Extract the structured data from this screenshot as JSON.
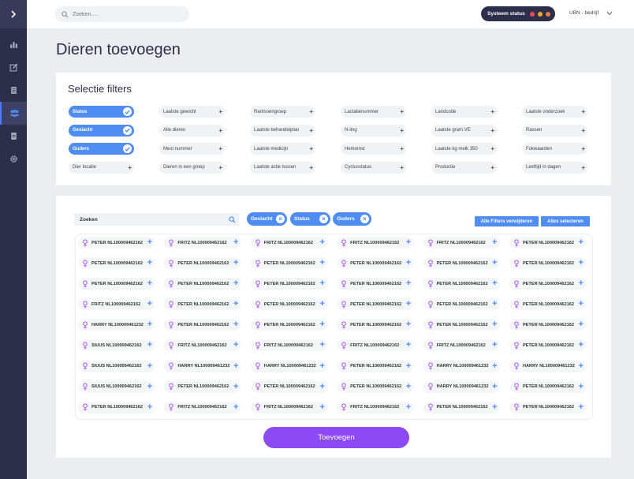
{
  "header": {
    "search_placeholder": "Zoeken.....",
    "system_status_label": "Systeem status",
    "status_colors": [
      "#e74c5e",
      "#f5a623",
      "#f07a3a"
    ],
    "user_label": "UBN - bedrijf"
  },
  "page": {
    "title": "Dieren toevoegen"
  },
  "filters": {
    "title": "Selectie filters",
    "items": [
      {
        "label": "Status",
        "selected": true
      },
      {
        "label": "Laatste gewicht",
        "selected": false
      },
      {
        "label": "Rantsoengroep",
        "selected": false
      },
      {
        "label": "Lactatienummer",
        "selected": false
      },
      {
        "label": "Landcode",
        "selected": false
      },
      {
        "label": "Laatste onderzoek",
        "selected": false
      },
      {
        "label": "Geslacht",
        "selected": true
      },
      {
        "label": "Alle dieren",
        "selected": false
      },
      {
        "label": "Laatste behandelplan",
        "selected": false
      },
      {
        "label": "N-ling",
        "selected": false
      },
      {
        "label": "Laatste gram VE",
        "selected": false
      },
      {
        "label": "Rassen",
        "selected": false
      },
      {
        "label": "Ouders",
        "selected": true
      },
      {
        "label": "Mest nummer",
        "selected": false
      },
      {
        "label": "Laatste medicijn",
        "selected": false
      },
      {
        "label": "Herkomst",
        "selected": false
      },
      {
        "label": "Laatste kg melk 350",
        "selected": false
      },
      {
        "label": "Fokwaarden",
        "selected": false
      },
      {
        "label": "Dier locatie",
        "selected": false
      },
      {
        "label": "Dieren in een groep",
        "selected": false
      },
      {
        "label": "Laatste actie tussen",
        "selected": false
      },
      {
        "label": "Cyclusstatus",
        "selected": false
      },
      {
        "label": "Productie",
        "selected": false
      },
      {
        "label": "Leeftijd in dagen",
        "selected": false
      }
    ]
  },
  "animals": {
    "search_placeholder": "Zoeken",
    "active_tags": [
      "Geslacht",
      "Status",
      "Ouders"
    ],
    "remove_all_label": "Alle Filters verwijderen",
    "select_all_label": "Alles selecteren",
    "rows": [
      [
        "PETER NL100009462162",
        "FRITZ NL100009462162",
        "FRITZ NL100009462162",
        "FRITZ NL100009462162",
        "FRITZ NL100009462162",
        "PETER NL100009462162"
      ],
      [
        "PETER NL100009462162",
        "PETER NL100009462162",
        "PETER NL100009462162",
        "PETER NL100009462162",
        "PETER NL100009462162",
        "PETER NL100009462162"
      ],
      [
        "PETER NL100009462162",
        "PETER NL100009462162",
        "PETER NL100009462162",
        "PETER NL100009462162",
        "PETER NL100009462162",
        "PETER NL100009462162"
      ],
      [
        "FRITZ NL100009462162",
        "PETER NL100009462162",
        "PETER NL100009462162",
        "PETER NL100009462162",
        "PETER NL100009462162",
        "PETER NL100009462162"
      ],
      [
        "HARRY NL100009461232",
        "PETER NL100009462162",
        "PETER NL100009462162",
        "PETER NL100009462162",
        "PETER NL100009462162",
        "PETER NL100009462162"
      ],
      [
        "SIUUS NL100009462162",
        "FRITZ NL100009462162",
        "FRITZ NL100009462162",
        "FRITZ NL100009462162",
        "FRITZ NL100009462162",
        "PETER NL100009462162"
      ],
      [
        "SIUUS NL100009462162",
        "HARRY NL100009461232",
        "HARRY NL100009461232",
        "PETER NL100009462162",
        "HARRY NL100009461232",
        "HARRY NL100009461232"
      ],
      [
        "SIUUS NL100009462162",
        "PETER NL100009462162",
        "PETER NL100009462162",
        "PETER NL100009462162",
        "HARRY NL100009461232",
        "PETER NL100009462162"
      ],
      [
        "PETER NL100009462162",
        "FRITZ NL100009462162",
        "FRITZ NL100009462162",
        "FRITZ NL100009462162",
        "PETER NL100009462162",
        "PETER NL100009462162"
      ]
    ],
    "add_button_label": "Toevoegen"
  },
  "colors": {
    "sidebar": "#2d2f4a",
    "accent_blue": "#4f8df5",
    "add_button": "#8b4af2",
    "gender_icon": "#b06ae8"
  }
}
